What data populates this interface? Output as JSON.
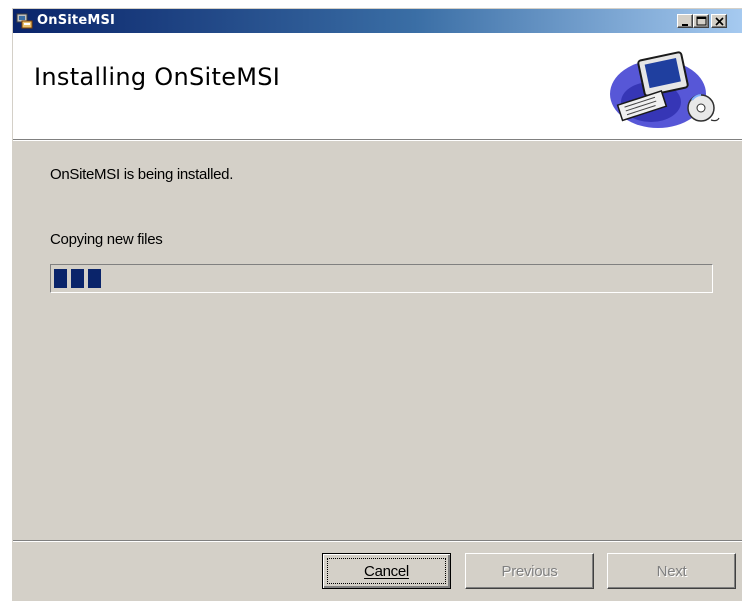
{
  "window": {
    "title": "OnSiteMSI",
    "icons": [
      "installer-app-icon",
      "minimize-icon",
      "maximize-icon",
      "close-icon"
    ]
  },
  "banner": {
    "title": "Installing OnSiteMSI",
    "art_icon": "computer-cd-illustration"
  },
  "main": {
    "description": "OnSiteMSI is being installed.",
    "status": "Copying new files",
    "progress_fraction": 0.08
  },
  "buttons": {
    "cancel": "Cancel",
    "previous": "Previous",
    "next": "Next"
  },
  "colors": {
    "titlebar_start": "#0a246a",
    "titlebar_end": "#a6caf0",
    "progress_fill": "#0a246a",
    "dialog_face": "#d4d0c8"
  }
}
